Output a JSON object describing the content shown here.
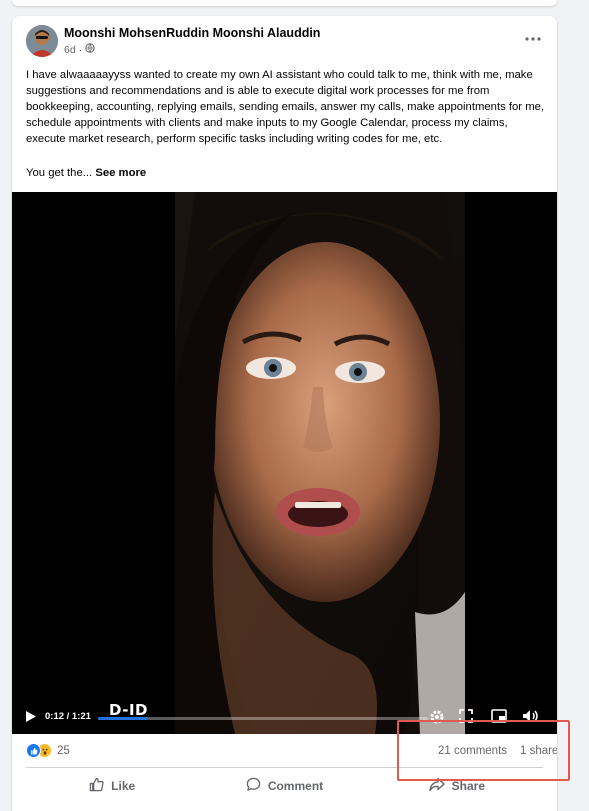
{
  "post": {
    "author": "Moonshi MohsenRuddin Moonshi Alauddin",
    "time": "6d",
    "visibility_icon": "globe-icon",
    "text": "I have alwaaaaayyss wanted to create my own AI assistant who could talk to me, think with me, make suggestions and recommendations and is able to execute digital work processes for me from bookkeeping, accounting, replying emails, sending emails, answer my calls, make appointments for me, schedule appointments with clients and make inputs to my Google Calendar, process my claims, execute market research, perform specific tasks including writing codes for me, etc.",
    "text_tail": "You get the...",
    "see_more": "See more"
  },
  "video": {
    "time": "0:12 / 1:21",
    "watermark": "D-ID",
    "progress": 0.15
  },
  "stats": {
    "reactions_count": "25",
    "reaction_icons": [
      "like-icon",
      "wow-icon"
    ],
    "comments": "21 comments",
    "shares": "1 share"
  },
  "actions": {
    "like": "Like",
    "comment": "Comment",
    "share": "Share"
  },
  "colors": {
    "accent": "#2374e1",
    "highlight": "#e05a52"
  }
}
